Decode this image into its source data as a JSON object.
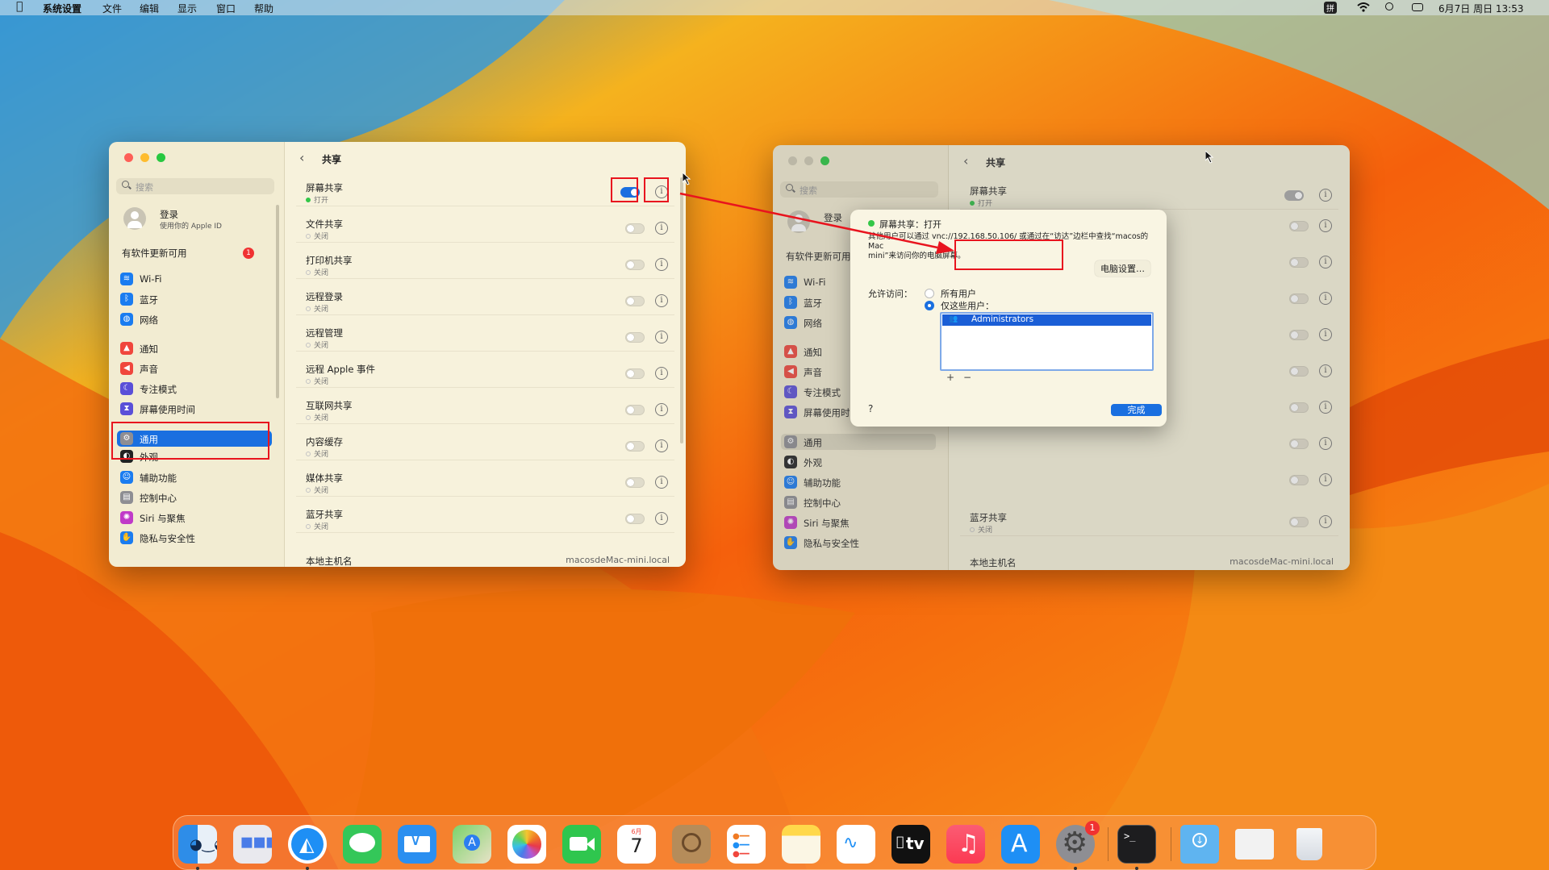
{
  "menubar": {
    "app_name": "系统设置",
    "menus": [
      "文件",
      "编辑",
      "显示",
      "窗口",
      "帮助"
    ],
    "input_method": "拼",
    "datetime": "6月7日 周日 13:53"
  },
  "sidebar": {
    "search_placeholder": "搜索",
    "login_title": "登录",
    "login_sub": "使用你的 Apple ID",
    "update_label": "有软件更新可用",
    "update_count": "1",
    "items": [
      {
        "label": "Wi-Fi",
        "icon": "wifi-icon",
        "color": "#1a7cf0"
      },
      {
        "label": "蓝牙",
        "icon": "bluetooth-icon",
        "color": "#1a7cf0"
      },
      {
        "label": "网络",
        "icon": "globe-icon",
        "color": "#1a7cf0"
      },
      {
        "label": "通知",
        "icon": "bell-icon",
        "color": "#f0463c"
      },
      {
        "label": "声音",
        "icon": "speaker-icon",
        "color": "#f0463c"
      },
      {
        "label": "专注模式",
        "icon": "moon-icon",
        "color": "#5a4fd8"
      },
      {
        "label": "屏幕使用时间",
        "icon": "hourglass-icon",
        "color": "#5a4fd8"
      },
      {
        "label": "通用",
        "icon": "gear-icon",
        "color": "#8e8e93"
      },
      {
        "label": "外观",
        "icon": "appearance-icon",
        "color": "#222222"
      },
      {
        "label": "辅助功能",
        "icon": "accessibility-icon",
        "color": "#1a7cf0"
      },
      {
        "label": "控制中心",
        "icon": "control-center-icon",
        "color": "#8e8e93"
      },
      {
        "label": "Siri 与聚焦",
        "icon": "siri-icon",
        "color": "#c03ac8"
      },
      {
        "label": "隐私与安全性",
        "icon": "hand-icon",
        "color": "#1a7cf0"
      }
    ]
  },
  "sharing": {
    "title": "共享",
    "services": [
      {
        "name": "屏幕共享",
        "status": "打开",
        "on": true
      },
      {
        "name": "文件共享",
        "status": "关闭",
        "on": false
      },
      {
        "name": "打印机共享",
        "status": "关闭",
        "on": false
      },
      {
        "name": "远程登录",
        "status": "关闭",
        "on": false
      },
      {
        "name": "远程管理",
        "status": "关闭",
        "on": false
      },
      {
        "name": "远程 Apple 事件",
        "status": "关闭",
        "on": false
      },
      {
        "name": "互联网共享",
        "status": "关闭",
        "on": false
      },
      {
        "name": "内容缓存",
        "status": "关闭",
        "on": false
      },
      {
        "name": "媒体共享",
        "status": "关闭",
        "on": false
      },
      {
        "name": "蓝牙共享",
        "status": "关闭",
        "on": false
      }
    ],
    "hostname_label": "本地主机名",
    "hostname_value": "macosdeMac-mini.local"
  },
  "dialog": {
    "title": "屏幕共享：打开",
    "desc_line1_a": "其他用户可以通过",
    "desc_vnc": "vnc://192.168.50.106/",
    "desc_line1_b": "或通过在“访达”边栏中查找“macos的Mac",
    "desc_line2_a": "mini”来访问你的",
    "desc_line2_b": "电脑屏幕。",
    "computer_settings_button": "电脑设置…",
    "allow_access_label": "允许访问：",
    "option_all_users": "所有用户",
    "option_these_users": "仅这些用户：",
    "users": [
      "Administrators"
    ],
    "add_button": "+",
    "remove_button": "−",
    "help_button": "?",
    "done_button": "完成"
  },
  "dock": {
    "apps": [
      {
        "name": "finder-icon",
        "color": "#2e8de8"
      },
      {
        "name": "launchpad-icon",
        "color": "#e9e9ee"
      },
      {
        "name": "safari-icon",
        "color": "#ffffff"
      },
      {
        "name": "messages-icon",
        "color": "#34c759"
      },
      {
        "name": "mail-icon",
        "color": "#2b8ff0"
      },
      {
        "name": "maps-icon",
        "color": "#7bd36a"
      },
      {
        "name": "photos-icon",
        "color": "#ffffff"
      },
      {
        "name": "facetime-icon",
        "color": "#2fc64e"
      },
      {
        "name": "calendar-icon",
        "color": "#ffffff"
      },
      {
        "name": "contacts-icon",
        "color": "#b58c5a"
      },
      {
        "name": "reminders-icon",
        "color": "#ffffff"
      },
      {
        "name": "notes-icon",
        "color": "#ffd84a"
      },
      {
        "name": "freeform-icon",
        "color": "#ffffff"
      },
      {
        "name": "tv-icon",
        "color": "#111111"
      },
      {
        "name": "music-icon",
        "color": "#fb3a52"
      },
      {
        "name": "app-store-icon",
        "color": "#1e8ff5"
      },
      {
        "name": "system-settings-icon",
        "color": "#8e8e93"
      },
      {
        "name": "terminal-icon",
        "color": "#1d1d1f"
      },
      {
        "name": "downloads-icon",
        "color": "#5fb4f0"
      },
      {
        "name": "preview-icon",
        "color": "#f2f2f2"
      },
      {
        "name": "trash-icon",
        "color": "#e6e9ee"
      }
    ],
    "calendar_month": "6月",
    "calendar_day": "7",
    "tv_label": "tv",
    "settings_badge": "1"
  }
}
